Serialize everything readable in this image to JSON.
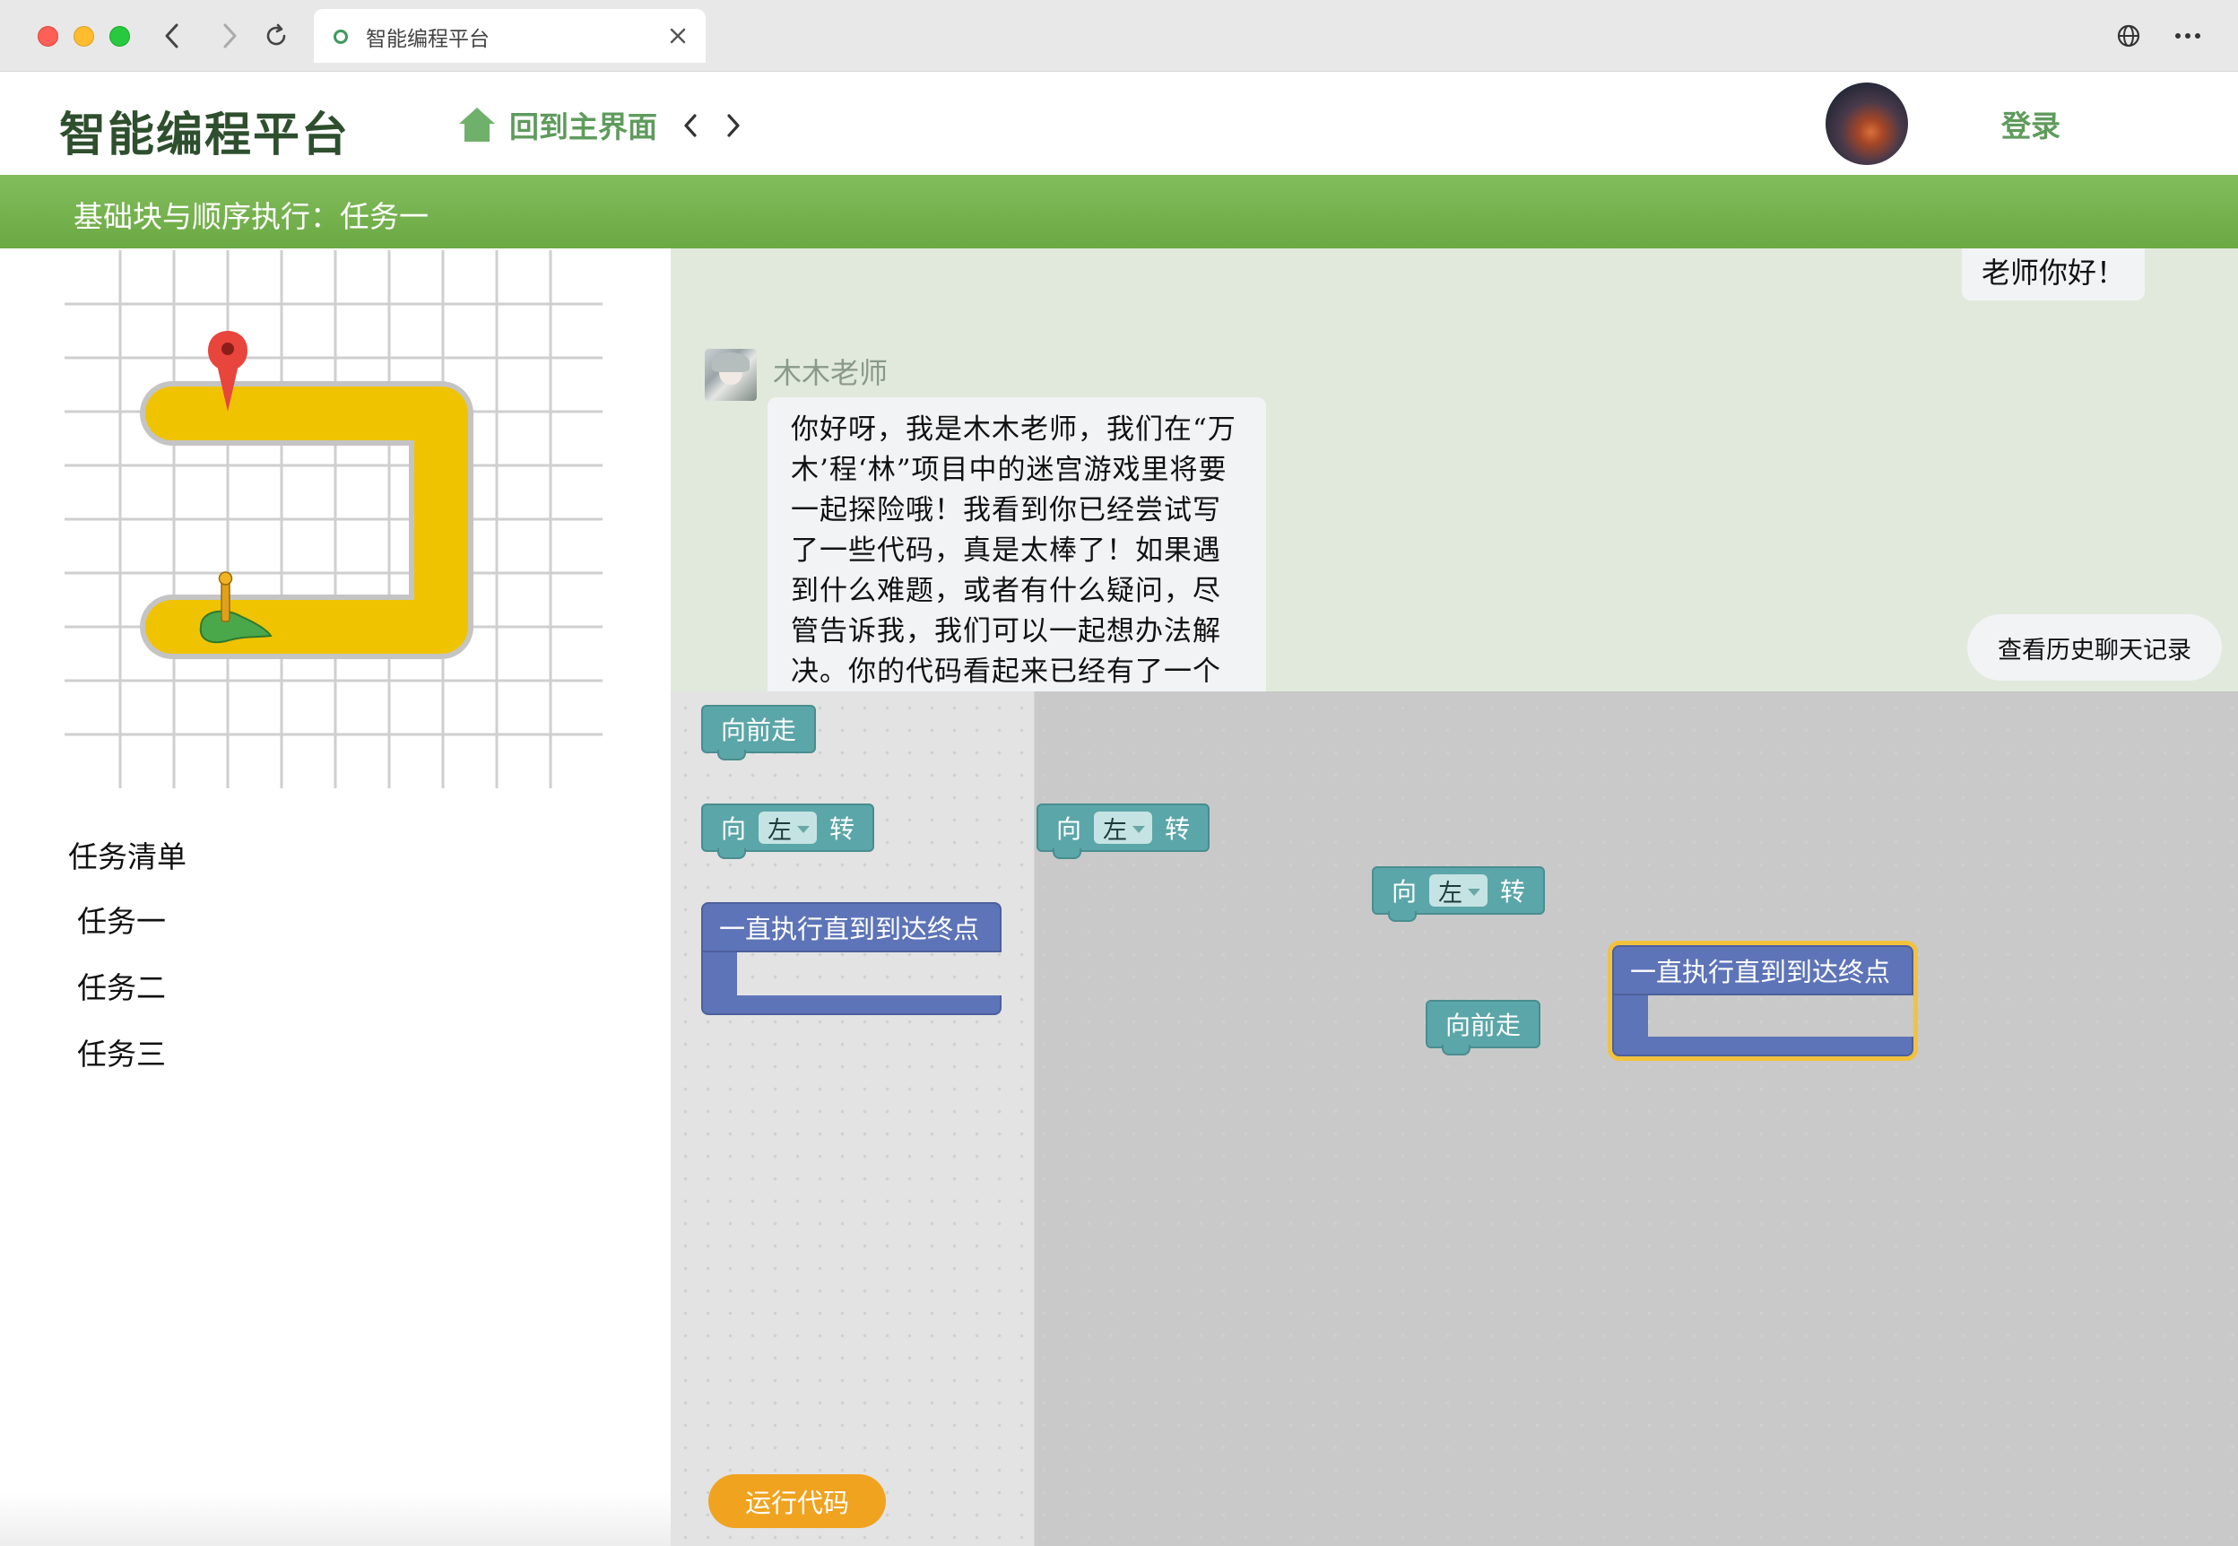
{
  "browser": {
    "tab_title": "智能编程平台"
  },
  "header": {
    "brand": "智能编程平台",
    "home_label": "回到主界面",
    "login_label": "登录"
  },
  "task_bar": {
    "title": "基础块与顺序执行：任务一"
  },
  "sidebar": {
    "task_list_title": "任务清单",
    "tasks": [
      {
        "label": "任务一"
      },
      {
        "label": "任务二"
      },
      {
        "label": "任务三"
      }
    ]
  },
  "chat": {
    "previous_message": "老师你好！",
    "teacher_name": "木木老师",
    "teacher_message": "你好呀，我是木木老师，我们在“万木’程‘林”项目中的迷宫游戏里将要一起探险哦！我看到你已经尝试写了一些代码，真是太棒了！如果遇到什么难题，或者有什么疑问，尽管告诉我，我们可以一起想办法解决。你的代码看起来已经有了一个很好的开",
    "history_button": "查看历史聊天记录"
  },
  "blocks": {
    "move_forward": "向前走",
    "turn_prefix": "向",
    "turn_suffix": "转",
    "turn_option": "左",
    "repeat_until_goal": "一直执行直到到达终点"
  },
  "run_button": "运行代码",
  "colors": {
    "brand_green": "#2e4f2e",
    "accent_green": "#5e9b5c",
    "bar_green": "#75b04e",
    "motion_block": "#5ba6a8",
    "loop_block": "#5e74b8",
    "selection_yellow": "#f2c23e",
    "run_orange": "#f0a31f",
    "maze_path": "#f0c300"
  },
  "icons": {
    "start_marker": "pegman-start-icon",
    "goal_marker": "map-pin-icon",
    "home": "home-icon"
  }
}
